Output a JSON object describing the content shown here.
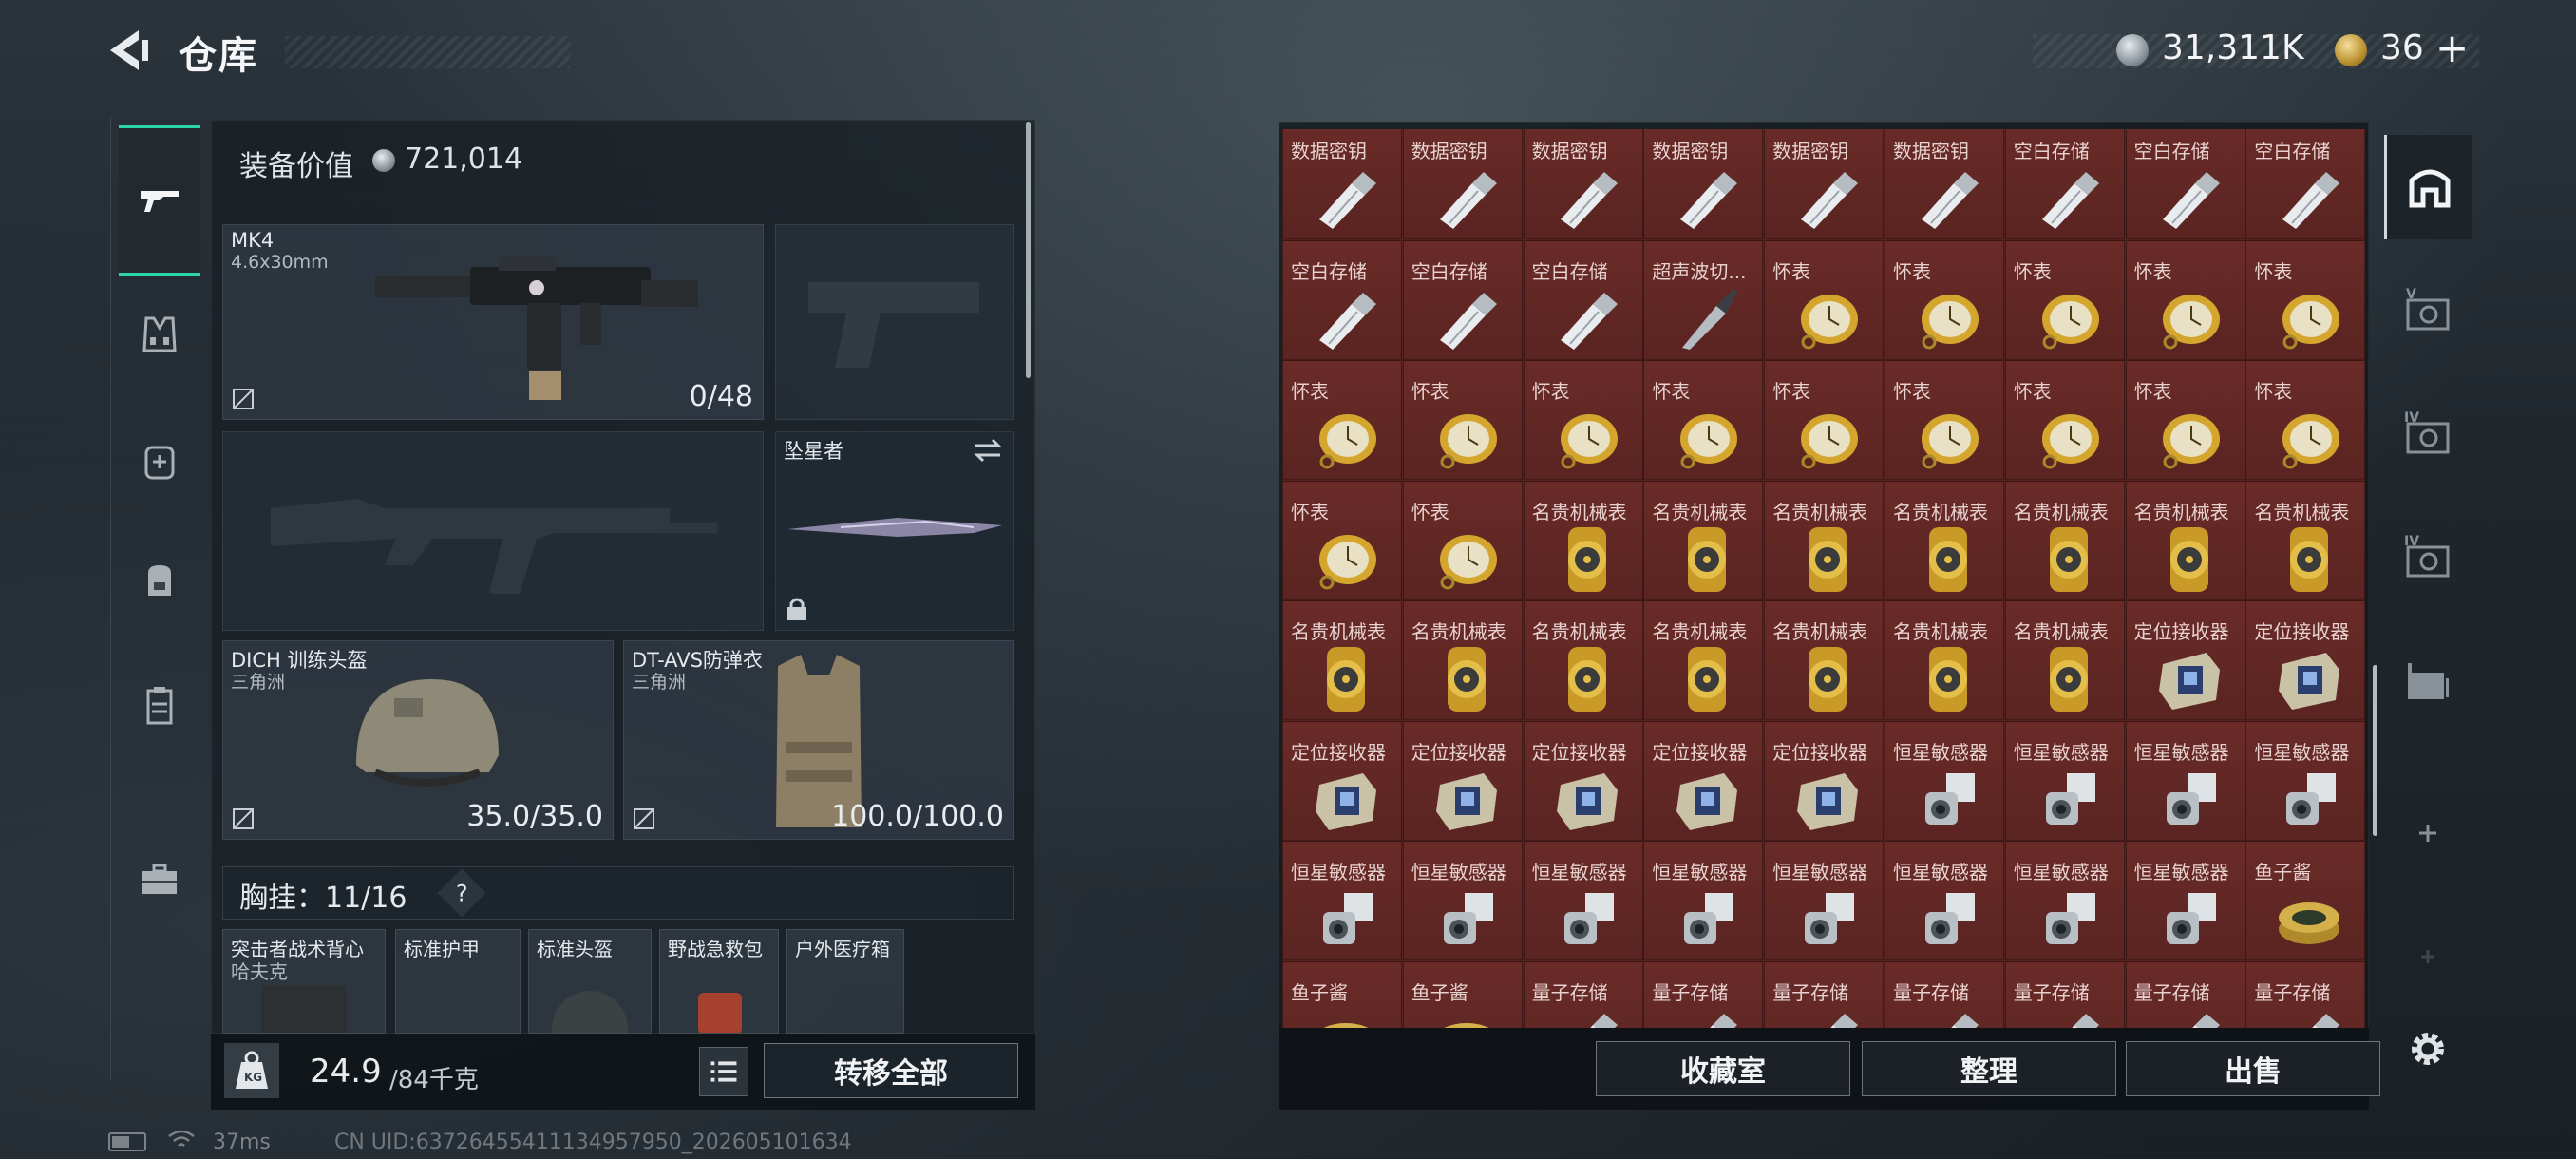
{
  "header": {
    "title": "仓库",
    "money": "31,311K",
    "tickets": "36",
    "tickets_plus": "+"
  },
  "equipment": {
    "value_label": "装备价值",
    "value": "721,014",
    "primary": {
      "name": "MK4",
      "caliber": "4.6x30mm",
      "ammo": "0/48"
    },
    "melee": {
      "name": "坠星者"
    },
    "helmet": {
      "name": "DICH 训练头盔",
      "sub": "三角洲",
      "durability": "35.0/35.0"
    },
    "armor": {
      "name": "DT-AVS防弹衣",
      "sub": "三角洲",
      "durability": "100.0/100.0"
    },
    "rig": {
      "label": "胸挂：",
      "capacity": "11/16",
      "help": "?"
    },
    "rig_items": [
      {
        "name": "突击者战术背心",
        "sub": "哈夫克"
      },
      {
        "name": "标准护甲",
        "sub": ""
      },
      {
        "name": "标准头盔",
        "sub": ""
      },
      {
        "name": "野战急救包",
        "sub": ""
      },
      {
        "name": "户外医疗箱",
        "sub": ""
      }
    ],
    "weight": "24.9",
    "weight_max": "/84千克",
    "transfer_all": "转移全部"
  },
  "storage": {
    "items": [
      "数据密钥",
      "数据密钥",
      "数据密钥",
      "数据密钥",
      "数据密钥",
      "数据密钥",
      "空白存储",
      "空白存储",
      "空白存储",
      "空白存储",
      "空白存储",
      "空白存储",
      "超声波切...",
      "怀表",
      "怀表",
      "怀表",
      "怀表",
      "怀表",
      "怀表",
      "怀表",
      "怀表",
      "怀表",
      "怀表",
      "怀表",
      "怀表",
      "怀表",
      "怀表",
      "怀表",
      "怀表",
      "名贵机械表",
      "名贵机械表",
      "名贵机械表",
      "名贵机械表",
      "名贵机械表",
      "名贵机械表",
      "名贵机械表",
      "名贵机械表",
      "名贵机械表",
      "名贵机械表",
      "名贵机械表",
      "名贵机械表",
      "名贵机械表",
      "名贵机械表",
      "定位接收器",
      "定位接收器",
      "定位接收器",
      "定位接收器",
      "定位接收器",
      "定位接收器",
      "定位接收器",
      "恒星敏感器",
      "恒星敏感器",
      "恒星敏感器",
      "恒星敏感器",
      "恒星敏感器",
      "恒星敏感器",
      "恒星敏感器",
      "恒星敏感器",
      "恒星敏感器",
      "恒星敏感器",
      "恒星敏感器",
      "恒星敏感器",
      "鱼子酱",
      "鱼子酱",
      "鱼子酱",
      "量子存储",
      "量子存储",
      "量子存储",
      "量子存储",
      "量子存储",
      "量子存储",
      "量子存储"
    ],
    "buttons": {
      "collection": "收藏室",
      "sort": "整理",
      "sell": "出售"
    }
  },
  "status": {
    "ping": "37ms",
    "uid": "CN UID:63726455411134957950_202605101634"
  },
  "icons": {
    "back": "back-arrow-icon",
    "nav": [
      "gun-icon",
      "vest-icon",
      "backpack-medic-icon",
      "backpack-icon",
      "locker-icon",
      "toolbox-icon"
    ],
    "right_tabs": [
      "all-items-icon",
      "tier-v-icon",
      "tier-iv-icon",
      "tier-iv-alt-icon",
      "storage-box-icon",
      "add-icon",
      "add-disabled-icon"
    ],
    "settings": "gear-icon"
  },
  "colors": {
    "accent": "#2bd6a8",
    "grid_bg": "#55221f",
    "cell": "#6a2b28"
  }
}
